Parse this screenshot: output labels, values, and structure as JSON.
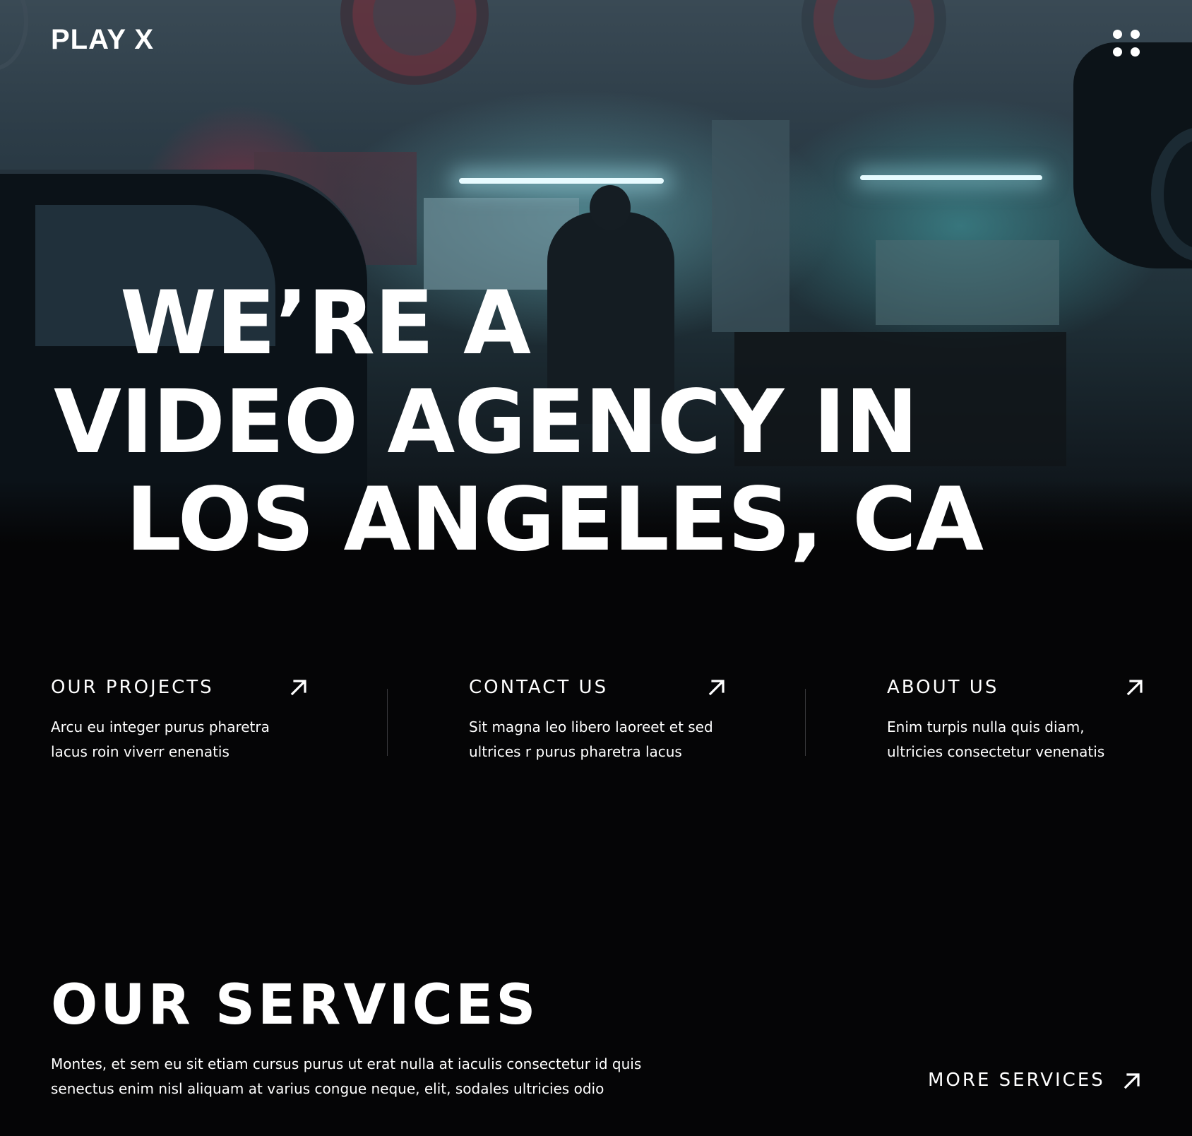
{
  "header": {
    "logo": "PLAY X",
    "menu_icon": "grid-dots-icon"
  },
  "hero": {
    "line1": "WE’RE A",
    "line2": "VIDEO AGENCY IN",
    "line3": "LOS ANGELES, CA",
    "background": "garage-workshop-photo"
  },
  "links": [
    {
      "title": "OUR PROJECTS",
      "line1": "Arcu eu integer purus pharetra",
      "line2": "lacus roin viverr enenatis",
      "icon": "arrow-up-right-icon"
    },
    {
      "title": "CONTACT US",
      "line1": "Sit magna leo libero laoreet et sed",
      "line2": "ultrices r purus pharetra lacus",
      "icon": "arrow-up-right-icon"
    },
    {
      "title": "ABOUT US",
      "line1": "Enim turpis nulla quis diam,",
      "line2": "ultricies consectetur venenatis",
      "icon": "arrow-up-right-icon"
    }
  ],
  "services": {
    "title": "OUR SERVICES",
    "line1": "Montes, et sem eu sit etiam cursus purus ut erat nulla at iaculis consectetur id quis",
    "line2": "senectus enim nisl aliquam at varius congue neque, elit, sodales ultricies odio",
    "more_label": "MORE SERVICES",
    "more_icon": "arrow-up-right-icon"
  },
  "colors": {
    "background": "#050506",
    "text": "#ffffff",
    "divider": "#3a3a3d"
  }
}
